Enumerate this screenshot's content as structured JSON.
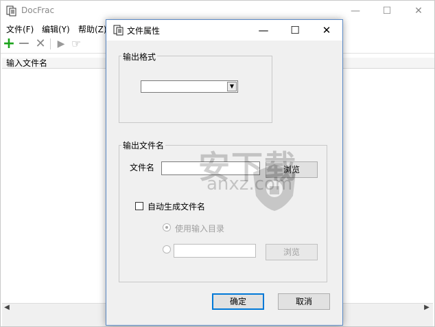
{
  "main_window": {
    "title": "DocFrac",
    "controls": {
      "minimize": "—",
      "maximize": "☐",
      "close": "✕"
    },
    "menu": [
      "文件(F)",
      "编辑(Y)",
      "帮助(Z)"
    ],
    "toolbar_icons": [
      "add-icon",
      "remove-icon",
      "delete-icon",
      "play-icon",
      "hand-pointer-icon"
    ],
    "toolbar_glyphs": {
      "add": "+",
      "remove": "−",
      "delete": "✕",
      "play": "▶",
      "hand": "☞"
    },
    "list_header": "输入文件名",
    "scroll_left": "◀",
    "scroll_right": "▶"
  },
  "dialog": {
    "title": "文件属性",
    "controls": {
      "minimize": "—",
      "maximize": "☐",
      "close": "✕"
    },
    "output_format": {
      "group_label": "输出格式",
      "selected_value": "",
      "dropdown_arrow": "▼"
    },
    "output_filename": {
      "group_label": "输出文件名",
      "file_name_label": "文件名",
      "browse_label": "浏览",
      "auto_checkbox_label": "自动生成文件名",
      "auto_checked": false,
      "use_input_dir_label": "使用输入目录",
      "custom_dir_value": "",
      "browse2_label": "浏览"
    },
    "ok_label": "确定",
    "cancel_label": "取消"
  },
  "watermark": {
    "title": "安下载",
    "subtitle": "anxz.com"
  },
  "colors": {
    "accent_border": "#5b8ac6",
    "add_icon": "#1aa31a",
    "default_button_border": "#0078d7"
  }
}
